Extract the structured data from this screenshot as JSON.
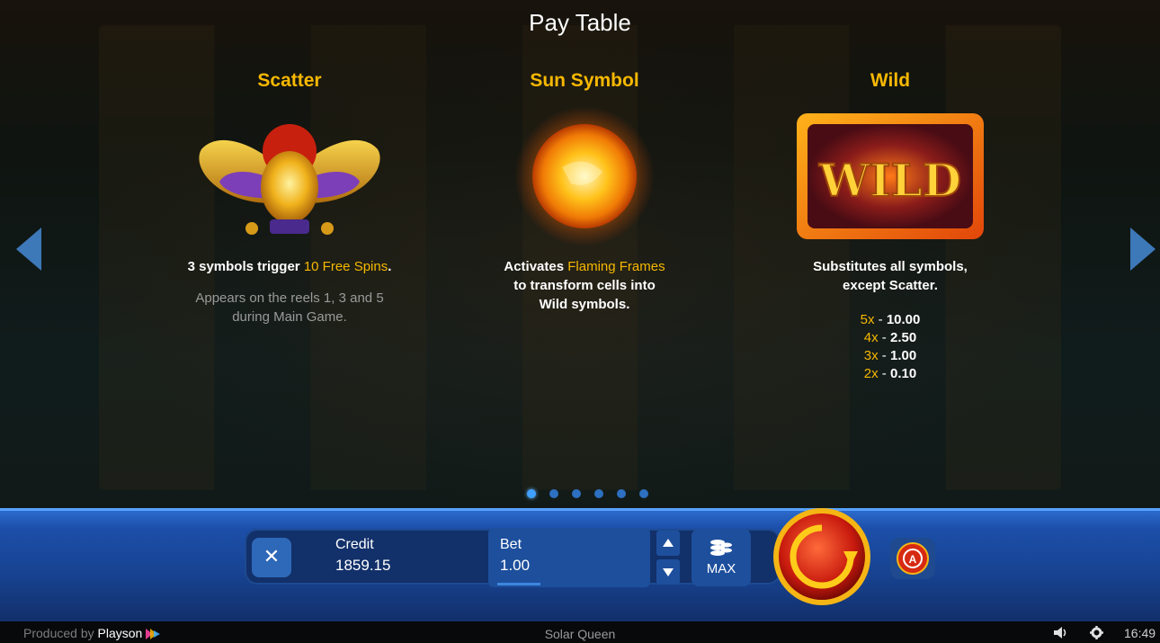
{
  "header": {
    "title": "Pay Table"
  },
  "columns": [
    {
      "title": "Scatter",
      "desc_pre": "3 symbols trigger ",
      "desc_hl": "10 Free Spins",
      "desc_post": ".",
      "sub_line1": "Appears on the reels 1, 3 and 5",
      "sub_line2": "during Main Game."
    },
    {
      "title": "Sun Symbol",
      "desc_pre": "Activates ",
      "desc_hl": "Flaming Frames",
      "line2": "to transform cells into",
      "line3": "Wild symbols."
    },
    {
      "title": "Wild",
      "line1": "Substitutes all symbols,",
      "line2": "except Scatter.",
      "symbol_text": "WILD",
      "pays": [
        {
          "mult": "5x",
          "sep": " - ",
          "value": "10.00"
        },
        {
          "mult": "4x",
          "sep": " - ",
          "value": "2.50"
        },
        {
          "mult": "3x",
          "sep": " - ",
          "value": "1.00"
        },
        {
          "mult": "2x",
          "sep": " - ",
          "value": "0.10"
        }
      ]
    }
  ],
  "pagination": {
    "pages": 6,
    "current": 1
  },
  "controls": {
    "close_label": "✕",
    "credit_label": "Credit",
    "credit_value": "1859.15",
    "bet_label": "Bet",
    "bet_value": "1.00",
    "max_label": "MAX",
    "auto_label": "A"
  },
  "footer": {
    "produced_by": "Produced by",
    "brand": "Playson",
    "game_name": "Solar Queen",
    "time": "16:49"
  },
  "colors": {
    "accent_gold": "#f7b800",
    "bar_blue": "#1c4faa",
    "arrow_blue": "#3d78b8",
    "spin_red": "#c81a0e"
  },
  "icons": [
    "chevron-left-icon",
    "chevron-right-icon",
    "close-icon",
    "coins-stack-icon",
    "spin-icon",
    "autoplay-icon",
    "volume-icon",
    "gear-icon",
    "playson-logo-icon"
  ]
}
